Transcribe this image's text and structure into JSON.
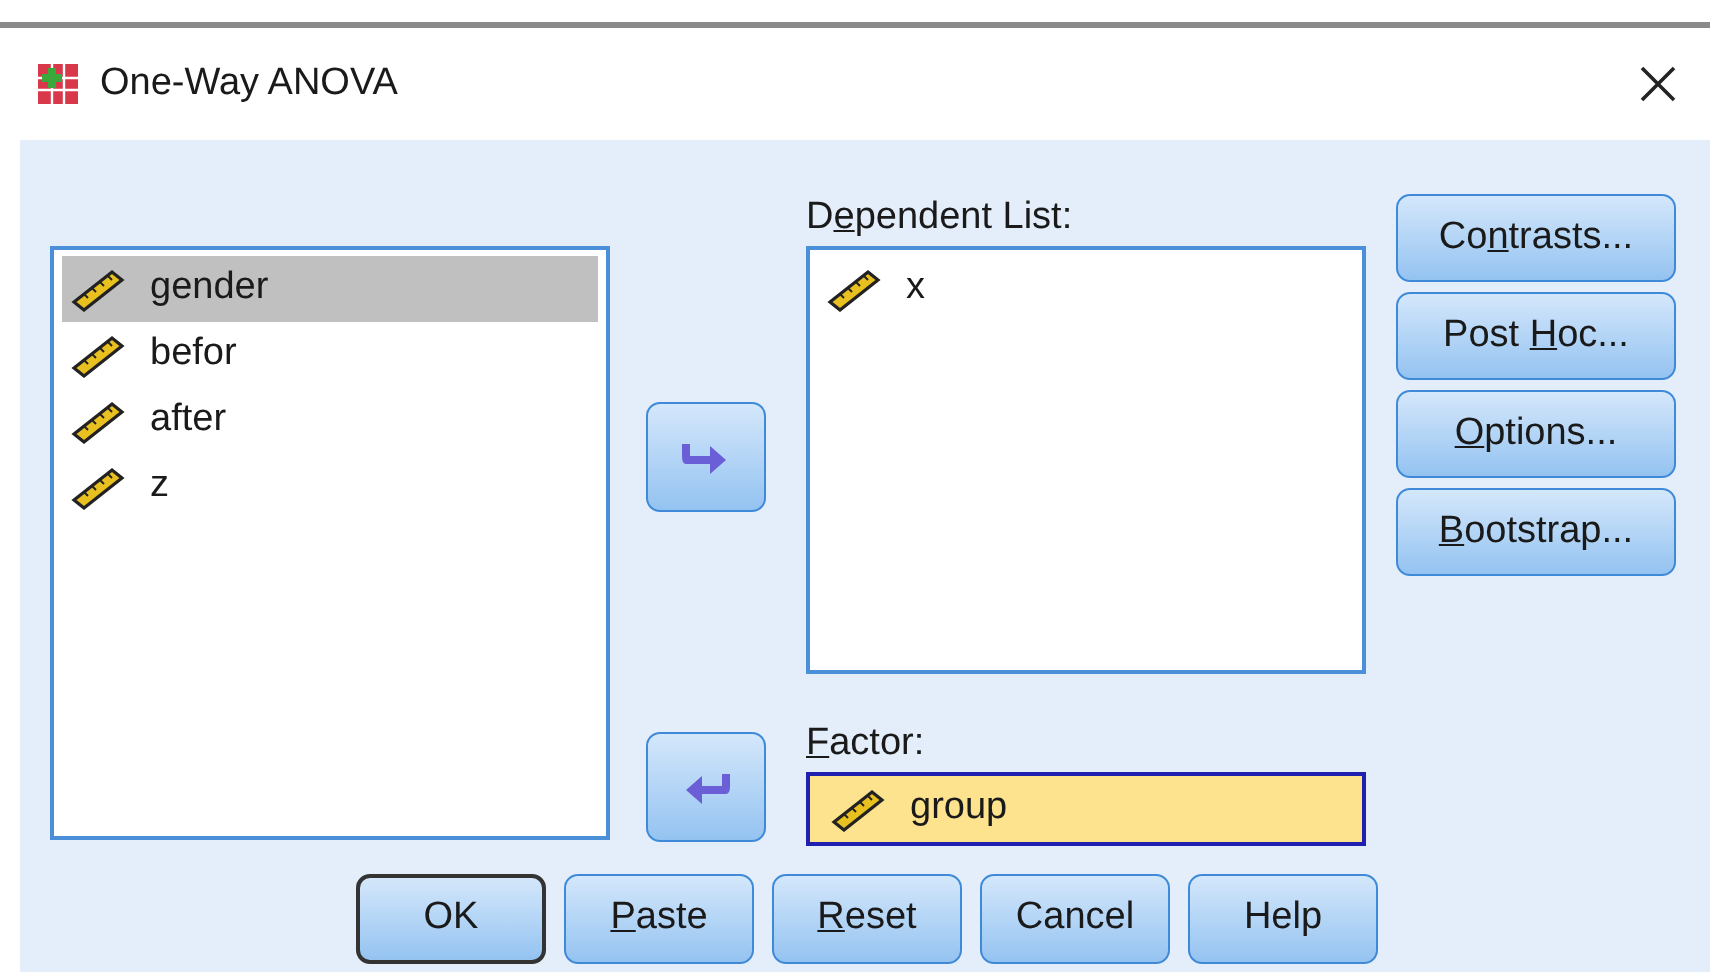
{
  "window": {
    "title": "One-Way ANOVA"
  },
  "source_list": {
    "items": [
      {
        "label": "gender",
        "selected": true
      },
      {
        "label": "befor",
        "selected": false
      },
      {
        "label": "after",
        "selected": false
      },
      {
        "label": "z",
        "selected": false
      }
    ]
  },
  "move_buttons": [
    {
      "kind": "right"
    },
    {
      "kind": "left"
    }
  ],
  "dependent_list": {
    "label": {
      "pre": "D",
      "key": "e",
      "post": "pendent List:"
    },
    "items": [
      {
        "label": "x",
        "selected": false
      }
    ]
  },
  "factor": {
    "label": {
      "key": "F",
      "post": "actor:"
    },
    "value": "group",
    "focused": true
  },
  "side_buttons": [
    {
      "pre": "Co",
      "key": "n",
      "post": "trasts..."
    },
    {
      "pre": "Post ",
      "key": "H",
      "post": "oc..."
    },
    {
      "key": "O",
      "post": "ptions..."
    },
    {
      "key": "B",
      "post": "ootstrap..."
    }
  ],
  "bottom_buttons": [
    {
      "pre": "OK",
      "default": true
    },
    {
      "key": "P",
      "post": "aste",
      "default": false
    },
    {
      "key": "R",
      "post": "eset",
      "default": false
    },
    {
      "pre": "Cancel",
      "default": false
    },
    {
      "pre": "Help",
      "default": false
    }
  ]
}
